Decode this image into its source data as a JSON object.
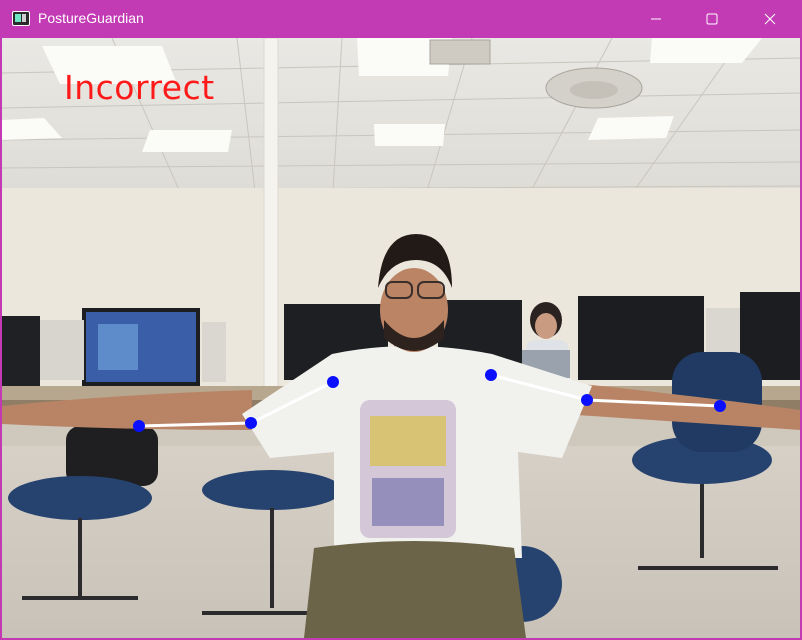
{
  "window": {
    "title": "PostureGuardian",
    "accent_color": "#c23ab4",
    "icons": {
      "app": "app-window-icon",
      "minimize": "minimize-icon",
      "maximize": "maximize-icon",
      "close": "close-icon"
    }
  },
  "camera": {
    "status_label": "Incorrect",
    "status_color": "#ff1a1a",
    "keypoint_color": "#0a10ff",
    "skeleton_color": "#ffffff"
  }
}
